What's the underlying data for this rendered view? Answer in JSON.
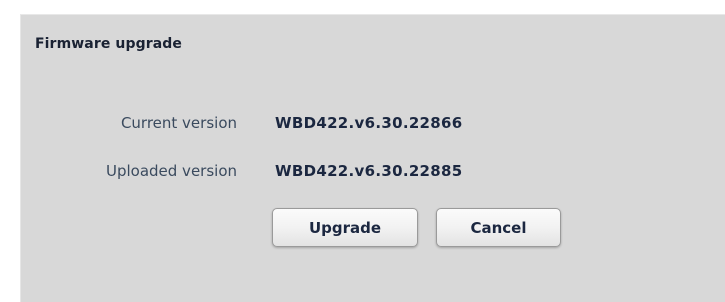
{
  "dialog": {
    "title": "Firmware upgrade",
    "rows": [
      {
        "label": "Current version",
        "value": "WBD422.v6.30.22866"
      },
      {
        "label": "Uploaded version",
        "value": "WBD422.v6.30.22885"
      }
    ],
    "buttons": {
      "upgrade_label": "Upgrade",
      "cancel_label": "Cancel"
    }
  }
}
